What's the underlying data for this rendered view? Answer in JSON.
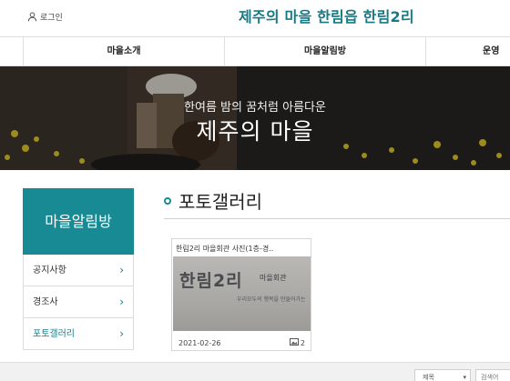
{
  "header": {
    "login_label": "로그인",
    "site_title": "제주의 마을 한림읍 한림2리",
    "login_icon": "person-icon",
    "brand_color": "#157a86"
  },
  "nav": {
    "items": [
      {
        "label": "마을소개"
      },
      {
        "label": "마을알림방"
      },
      {
        "label": "운영"
      }
    ]
  },
  "hero": {
    "subtitle": "한여름 밤의 꿈처럼 아름다운",
    "title": "제주의 마을"
  },
  "sidebar": {
    "heading": "마을알림방",
    "accent_color": "#178a93",
    "items": [
      {
        "label": "공지사항",
        "active": false
      },
      {
        "label": "경조사",
        "active": false
      },
      {
        "label": "포토갤러리",
        "active": true
      }
    ],
    "chevron_icon": "chevron-right-icon"
  },
  "content": {
    "section_title": "포토갤러리",
    "cards": [
      {
        "title": "한림2리 마을회관 사진(1층-경..",
        "thumb_text_big": "한림2리",
        "thumb_text_small": "마을회관",
        "thumb_text_line": "우리모두의 행복을 만들어가는",
        "date": "2021-02-26",
        "count": "2",
        "count_icon": "image-icon"
      }
    ]
  },
  "search": {
    "select_value": "제목",
    "input_placeholder": "검색어"
  }
}
